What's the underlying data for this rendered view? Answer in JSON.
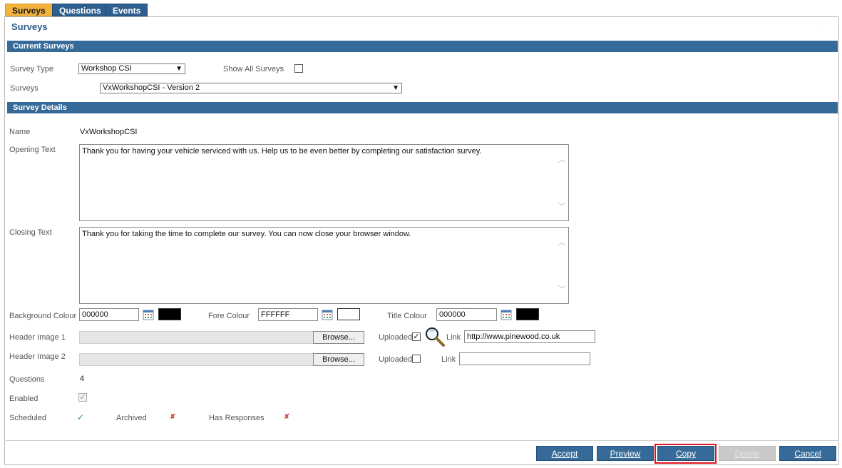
{
  "tabs": [
    {
      "label": "Surveys",
      "active": true
    },
    {
      "label": "Questions",
      "active": false
    },
    {
      "label": "Events",
      "active": false
    }
  ],
  "page": {
    "title": "Surveys"
  },
  "sections": {
    "current": "Current Surveys",
    "details": "Survey Details"
  },
  "current": {
    "survey_type_label": "Survey Type",
    "survey_type_value": "Workshop CSI",
    "show_all_label": "Show All Surveys",
    "show_all_checked": false,
    "surveys_label": "Surveys",
    "surveys_value": "VxWorkshopCSI - Version 2"
  },
  "details": {
    "name_label": "Name",
    "name_value": "VxWorkshopCSI",
    "opening_label": "Opening Text",
    "opening_text": "Thank you for having your vehicle serviced with us.  Help us to be even better by completing our satisfaction survey.",
    "closing_label": "Closing Text",
    "closing_text": "Thank you for taking the time to complete our survey.  You can now close your browser window.",
    "bg_colour_label": "Background Colour",
    "bg_colour_value": "000000",
    "bg_colour_hex": "#000000",
    "fore_colour_label": "Fore Colour",
    "fore_colour_value": "FFFFFF",
    "fore_colour_hex": "#FFFFFF",
    "title_colour_label": "Title Colour",
    "title_colour_value": "000000",
    "title_colour_hex": "#000000",
    "header1_label": "Header Image 1",
    "header2_label": "Header Image 2",
    "browse_label": "Browse...",
    "uploaded_label": "Uploaded",
    "header1_uploaded": true,
    "header2_uploaded": false,
    "link_label": "Link",
    "header1_link": "http://www.pinewood.co.uk",
    "header2_link": "",
    "questions_label": "Questions",
    "questions_value": "4",
    "enabled_label": "Enabled",
    "enabled_checked": true,
    "scheduled_label": "Scheduled",
    "scheduled_value": true,
    "archived_label": "Archived",
    "archived_value": false,
    "has_responses_label": "Has Responses",
    "has_responses_value": false
  },
  "icons": {
    "calendar": "calendar-icon",
    "magnifier": "magnifier-icon",
    "check": "check-icon",
    "cross": "cross-icon",
    "chevron": "chevron-down-icon"
  },
  "glyphs": {
    "check": "✓",
    "cross": "✘",
    "arrow": "▼",
    "up": "︿",
    "down": "﹀"
  },
  "colors": {
    "accent": "#366b99",
    "active_tab": "#f3b23b",
    "highlight": "#e0141e",
    "check": "#2aa02a",
    "cross": "#c0392b"
  },
  "buttons": {
    "accept": "Accept",
    "preview": "Preview",
    "copy": "Copy",
    "delete": "Delete",
    "cancel": "Cancel"
  }
}
